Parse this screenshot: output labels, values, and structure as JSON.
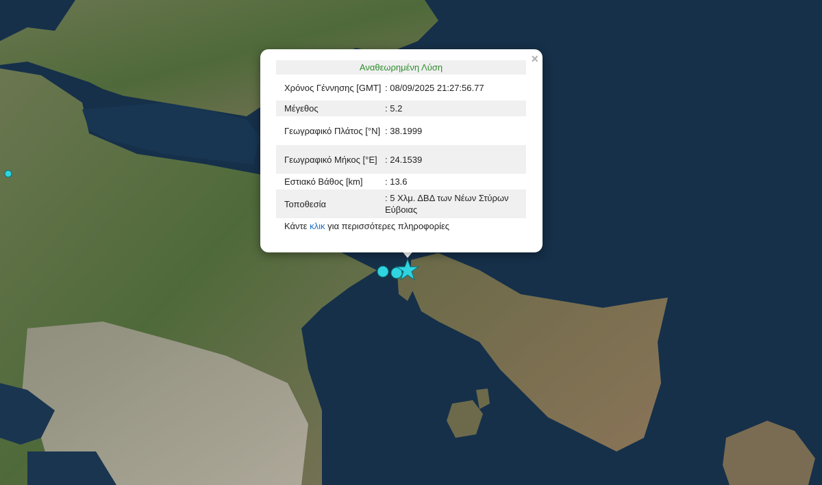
{
  "popup": {
    "title": "Αναθεωρημένη Λύση",
    "close": "×",
    "rows": [
      {
        "label": "Χρόνος Γέννησης [GMT]",
        "value": ": 08/09/2025 21:27:56.77"
      },
      {
        "label": "Μέγεθος",
        "value": ": 5.2"
      },
      {
        "label": "Γεωγραφικό Πλάτος [°N]",
        "value": ": 38.1999"
      },
      {
        "label": "Γεωγραφικό Μήκος [°E]",
        "value": ": 24.1539"
      },
      {
        "label": "Εστιακό Βάθος [km]",
        "value": ": 13.6"
      },
      {
        "label": "Τοποθεσία",
        "value": ": 5 Χλμ. ΔΒΔ των Νέων Στύρων Εύβοιας"
      }
    ],
    "more_prefix": "Κάντε ",
    "more_link": "κλικ",
    "more_suffix": " για περισσότερες πληροφορίες"
  },
  "markers": {
    "epicenter": "star-icon",
    "color": "#2fd4e0"
  },
  "colors": {
    "sea": "#16304a",
    "land": "#5b6b45",
    "popup_title": "#2e8b2e",
    "link": "#1a6fc4"
  }
}
